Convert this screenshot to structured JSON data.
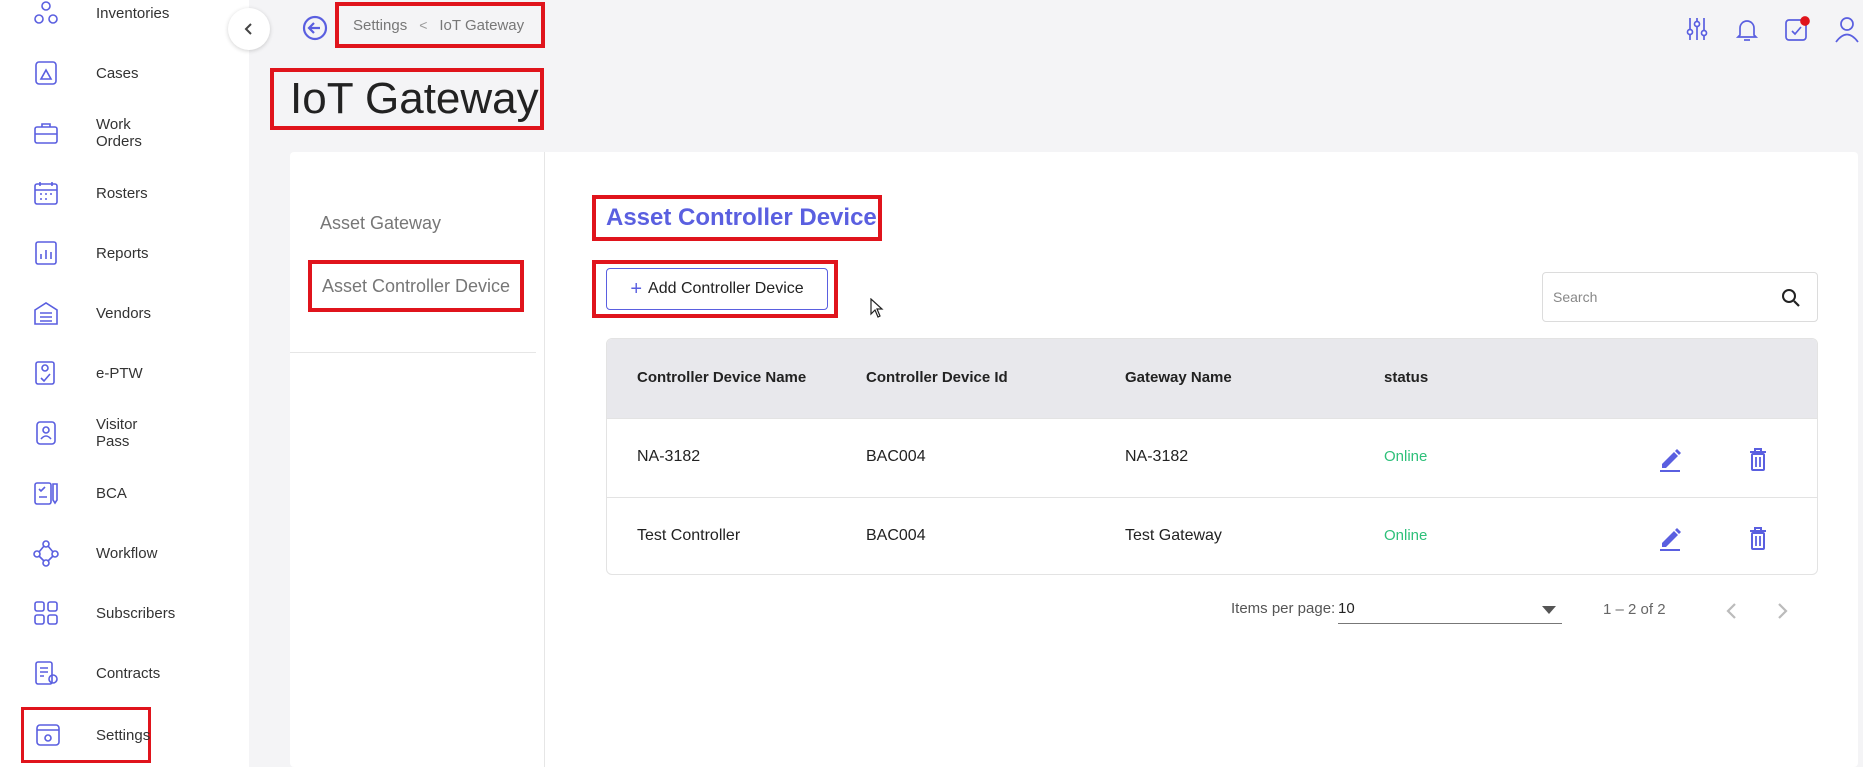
{
  "sidebar": {
    "items": [
      {
        "label": "Inventories",
        "icon": "inventories-icon"
      },
      {
        "label": "Cases",
        "icon": "cases-icon"
      },
      {
        "label": "Work Orders",
        "icon": "work-orders-icon"
      },
      {
        "label": "Rosters",
        "icon": "rosters-icon"
      },
      {
        "label": "Reports",
        "icon": "reports-icon"
      },
      {
        "label": "Vendors",
        "icon": "vendors-icon"
      },
      {
        "label": "e-PTW",
        "icon": "eptw-icon"
      },
      {
        "label": "Visitor Pass",
        "icon": "visitor-pass-icon"
      },
      {
        "label": "BCA",
        "icon": "bca-icon"
      },
      {
        "label": "Workflow",
        "icon": "workflow-icon"
      },
      {
        "label": "Subscribers",
        "icon": "subscribers-icon"
      },
      {
        "label": "Contracts",
        "icon": "contracts-icon"
      },
      {
        "label": "Settings",
        "icon": "settings-icon",
        "active": true
      }
    ]
  },
  "breadcrumb": {
    "parent": "Settings",
    "current": "IoT Gateway"
  },
  "header": {
    "title": "IoT Gateway",
    "icons": [
      "filters-icon",
      "bell-icon",
      "tasks-icon",
      "user-icon"
    ],
    "accent": "#5a5fe0"
  },
  "left_menu": {
    "tabs": [
      {
        "label": "Asset Gateway"
      },
      {
        "label": "Asset Controller Device",
        "active": true
      }
    ]
  },
  "main": {
    "section_title": "Asset Controller Device",
    "add_button": "Add Controller Device",
    "search_placeholder": "Search"
  },
  "table": {
    "columns": [
      "Controller Device Name",
      "Controller Device Id",
      "Gateway Name",
      "status"
    ],
    "rows": [
      {
        "name": "NA-3182",
        "device_id": "BAC004",
        "gateway": "NA-3182",
        "status": "Online"
      },
      {
        "name": "Test Controller",
        "device_id": "BAC004",
        "gateway": "Test Gateway",
        "status": "Online"
      }
    ],
    "status_color": "#2ec07a"
  },
  "pagination": {
    "items_per_page_label": "Items per page:",
    "items_per_page": "10",
    "range": "1 – 2 of 2"
  },
  "highlight_color": "#e0141c"
}
